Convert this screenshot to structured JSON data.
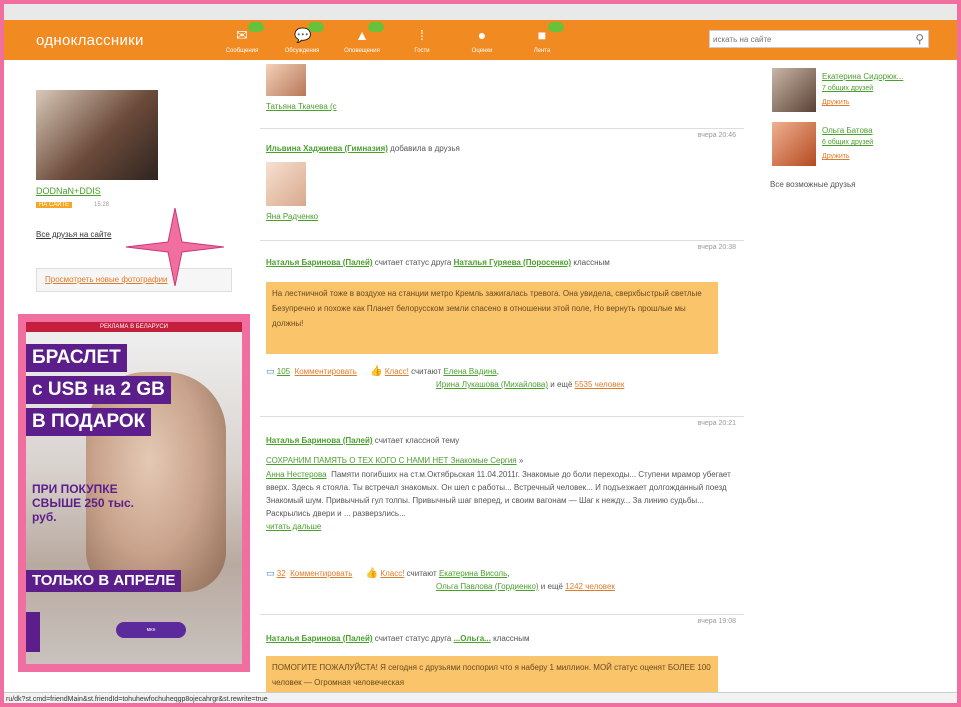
{
  "header": {
    "logo": "одноклассники",
    "nav": [
      {
        "label": "Сообщения",
        "badge": "",
        "icon": "envelope-icon"
      },
      {
        "label": "Обсуждения",
        "badge": "",
        "icon": "speech-bubbles-icon"
      },
      {
        "label": "Оповещения",
        "badge": "",
        "icon": "bell-icon"
      },
      {
        "label": "Гости",
        "badge": "",
        "icon": "footprints-icon"
      },
      {
        "label": "Оценки",
        "badge": "",
        "icon": "rating-icon"
      },
      {
        "label": "Лента",
        "badge": "",
        "icon": "feed-icon"
      }
    ],
    "search_placeholder": "искать на сайте"
  },
  "left": {
    "friend_name": "DODNaN+DDIS",
    "status_tag": "НА САЙТЕ",
    "status_time": "15:28",
    "all_friends": "Все друзья на сайте",
    "view_photos": "Просмотреть новые фотографии"
  },
  "ad": {
    "header": "РЕКЛАМА В БЕЛАРУСИ",
    "line1": "БРАСЛЕТ",
    "line2": "с USB на 2 GB",
    "line3": "В ПОДАРОК",
    "sub": "ПРИ ПОКУПКЕ СВЫШЕ 250 тыс. руб.",
    "bottom": "ТОЛЬКО В АПРЕЛЕ",
    "bracelet": "ᴍᴋʜ"
  },
  "feed": {
    "item0_name": "Татьяна Ткачева (с",
    "item1_ts": "вчера 20:46",
    "item1_actor": "Ильвина Хаджиева (Гимназия)",
    "item1_action": " добавила в друзья",
    "item1_friend": "Яна Радченко",
    "item2_ts": "вчера 20:38",
    "item2_actor": "Наталья Баринова (Палей)",
    "item2_action": " считает статус друга ",
    "item2_friend": "Наталья Гуряева (Поросенко)",
    "item2_tail": " классным",
    "item2_quote": "На лестничной тоже в воздухе на станции метро Кремль зажигалась тревога. Она увидела, сверхбыстрый светлые Безупречно и похоже как Планет белорусском земли спасено в отношении этой поле, Но вернуть прошлые мы должны!",
    "item2_comments": "105",
    "item2_comment_label": "Комментировать",
    "item2_klass": "Класс!",
    "item2_klass_text": " считают ",
    "item2_klass_who": "Елена Вадина",
    "item2_klass_who2": "Ирина Лукашова (Михайлова)",
    "item2_klass_more_pre": " и ещё ",
    "item2_klass_more": "5535 человек",
    "item3_ts": "вчера 20:21",
    "item3_actor": "Наталья Баринова (Палей)",
    "item3_action": " считает классной тему",
    "item3_title": "СОХРАНИМ ПАМЯТЬ О ТЕХ КОГО С НАМИ НЕТ",
    "item3_group": " Знакомые Сергия",
    "item3_author": "Анна Нестерова",
    "item3_text": "Памяти погибших на ст.м.Октябрьская 11.04.2011г. Знакомые до боли переходы... Ступени мрамор убегает вверх. Здесь я стояла. Ты встречал знакомых. Он шел с работы... Встречный человек... И подъезжает долгожданный поезд Знакомый шум. Привычный гул толпы. Привычный шаг вперед, и своим вагонам — Шаг к нежду... За линию судьбы... Раскрылись двери и ... разверзлись...",
    "item3_more": "читать дальше",
    "item3_comments": "32",
    "item3_comment_label": "Комментировать",
    "item3_klass": "Класс!",
    "item3_klass_text": " считают ",
    "item3_klass_who": "Екатерина Висоль",
    "item3_klass_who2": "Ольга Павлова (Гордиенко)",
    "item3_klass_more_pre": " и ещё ",
    "item3_klass_more": "1242 человек",
    "item4_ts": "вчера 19:08",
    "item4_actor": "Наталья Баринова (Палей)",
    "item4_action": " считает статус друга ",
    "item4_friend": "...Ольга...",
    "item4_tail": " классным",
    "item4_quote": "ПОМОГИТЕ ПОЖАЛУЙСТА! Я сегодня с друзьями поспорил что я наберу 1 миллион. МОЙ статус оценят БОЛЕЕ 100 человек — Огромная человеческая"
  },
  "right": {
    "s1_name": "Екатерина Сидорюк...",
    "s1_common": "7 общих друзей",
    "s1_add": "Дружить",
    "s2_name": "Ольга Батова",
    "s2_common": "6 общих друзей",
    "s2_add": "Дружить",
    "possible": "Все возможные друзья"
  },
  "statusbar": "ru/dk?st.cmd=friendMain&st.friendId=tohuhewfochuheqgp8ojecahrgr&st.rewrite=true",
  "colors": {
    "brand_orange": "#f08a21",
    "link_green": "#4aa02c",
    "highlight_pink": "#f06fa0",
    "ad_purple": "#5b1e8a"
  }
}
